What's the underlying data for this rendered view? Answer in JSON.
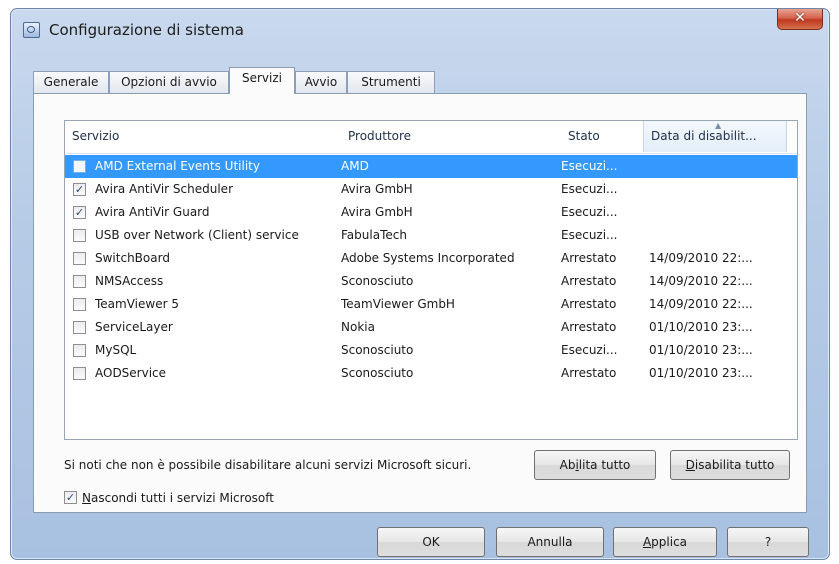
{
  "window": {
    "title": "Configurazione di sistema",
    "close_glyph": "✕"
  },
  "tabs": [
    {
      "label": "Generale",
      "active": false
    },
    {
      "label": "Opzioni di avvio",
      "active": false
    },
    {
      "label": "Servizi",
      "active": true
    },
    {
      "label": "Avvio",
      "active": false
    },
    {
      "label": "Strumenti",
      "active": false
    }
  ],
  "columns": [
    "Servizio",
    "Produttore",
    "Stato",
    "Data di disabilit..."
  ],
  "services": [
    {
      "checked": false,
      "name": "AMD External Events Utility",
      "vendor": "AMD",
      "state": "Esecuzi...",
      "date": "",
      "selected": true
    },
    {
      "checked": true,
      "name": "Avira AntiVir Scheduler",
      "vendor": "Avira GmbH",
      "state": "Esecuzi...",
      "date": ""
    },
    {
      "checked": true,
      "name": "Avira AntiVir Guard",
      "vendor": "Avira GmbH",
      "state": "Esecuzi...",
      "date": ""
    },
    {
      "checked": false,
      "name": "USB over Network (Client) service",
      "vendor": "FabulaTech",
      "state": "Esecuzi...",
      "date": ""
    },
    {
      "checked": false,
      "name": "SwitchBoard",
      "vendor": "Adobe Systems Incorporated",
      "state": "Arrestato",
      "date": "14/09/2010 22:..."
    },
    {
      "checked": false,
      "name": "NMSAccess",
      "vendor": "Sconosciuto",
      "state": "Arrestato",
      "date": "14/09/2010 22:..."
    },
    {
      "checked": false,
      "name": "TeamViewer 5",
      "vendor": "TeamViewer GmbH",
      "state": "Arrestato",
      "date": "14/09/2010 22:..."
    },
    {
      "checked": false,
      "name": "ServiceLayer",
      "vendor": "Nokia",
      "state": "Arrestato",
      "date": "01/10/2010 23:..."
    },
    {
      "checked": false,
      "name": "MySQL",
      "vendor": "Sconosciuto",
      "state": "Esecuzi...",
      "date": "01/10/2010 23:..."
    },
    {
      "checked": false,
      "name": "AODService",
      "vendor": "Sconosciuto",
      "state": "Arrestato",
      "date": "01/10/2010 23:..."
    }
  ],
  "note": "Si noti che non è possibile disabilitare alcuni servizi Microsoft sicuri.",
  "enable_all": {
    "pre": "Ab",
    "key": "i",
    "post": "lita tutto"
  },
  "disable_all": {
    "pre": "",
    "key": "D",
    "post": "isabilita tutto"
  },
  "hide_microsoft": {
    "checked": true,
    "pre": "",
    "key": "N",
    "post": "ascondi tutti i servizi Microsoft"
  },
  "buttons": {
    "ok": "OK",
    "cancel": "Annulla",
    "apply": {
      "pre": "",
      "key": "A",
      "post": "pplica"
    },
    "help": "?"
  },
  "icons": {
    "app": "msconfig-icon",
    "check": "✓"
  }
}
